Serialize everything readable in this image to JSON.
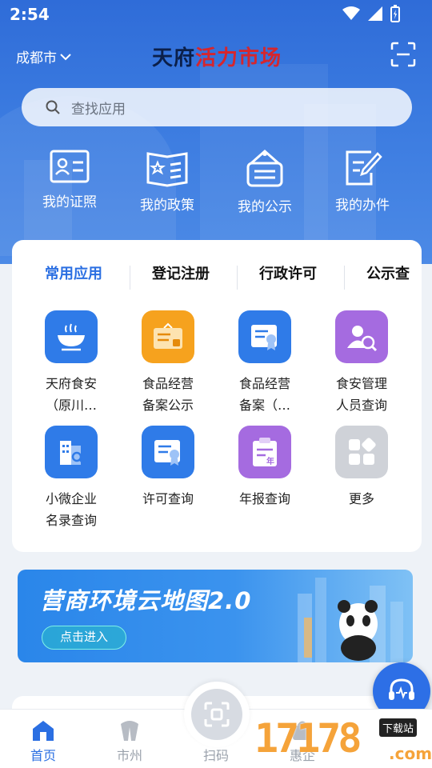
{
  "status": {
    "time": "2:54"
  },
  "header": {
    "city": "成都市",
    "logo_black": "天府",
    "logo_red": "活力市场"
  },
  "search": {
    "placeholder": "查找应用"
  },
  "quick": [
    {
      "label": "我的证照",
      "icon": "id-card-icon"
    },
    {
      "label": "我的政策",
      "icon": "policy-book-icon"
    },
    {
      "label": "我的公示",
      "icon": "notice-board-icon"
    },
    {
      "label": "我的办件",
      "icon": "edit-document-icon"
    }
  ],
  "tabs": [
    "常用应用",
    "登记注册",
    "行政许可",
    "公示查"
  ],
  "apps": [
    {
      "line1": "天府食安",
      "line2": "（原川…",
      "color": "#2f7be8",
      "icon": "food-bowl-icon"
    },
    {
      "line1": "食品经营",
      "line2": "备案公示",
      "color": "#f6a21e",
      "icon": "certificate-board-icon"
    },
    {
      "line1": "食品经营",
      "line2": "备案（…",
      "color": "#2f7be8",
      "icon": "certificate-icon"
    },
    {
      "line1": "食安管理",
      "line2": "人员查询",
      "color": "#a56be0",
      "icon": "person-search-icon"
    },
    {
      "line1": "小微企业",
      "line2": "名录查询",
      "color": "#2f7be8",
      "icon": "building-search-icon"
    },
    {
      "line1": "许可查询",
      "line2": "",
      "color": "#2f7be8",
      "icon": "license-icon"
    },
    {
      "line1": "年报查询",
      "line2": "",
      "color": "#a56be0",
      "icon": "annual-report-icon"
    },
    {
      "line1": "更多",
      "line2": "",
      "color": "#cfd2d8",
      "icon": "more-apps-icon"
    }
  ],
  "banner": {
    "title": "营商环境云地图2.0",
    "button": "点击进入"
  },
  "nav": [
    {
      "label": "首页",
      "icon": "home-icon"
    },
    {
      "label": "市州",
      "icon": "city-icon"
    },
    {
      "label": "扫码",
      "icon": "scan-icon"
    },
    {
      "label": "惠企",
      "icon": "benefit-icon"
    }
  ],
  "watermark": {
    "digits": "17178",
    "tag": "下载站",
    "domain": ".com"
  }
}
